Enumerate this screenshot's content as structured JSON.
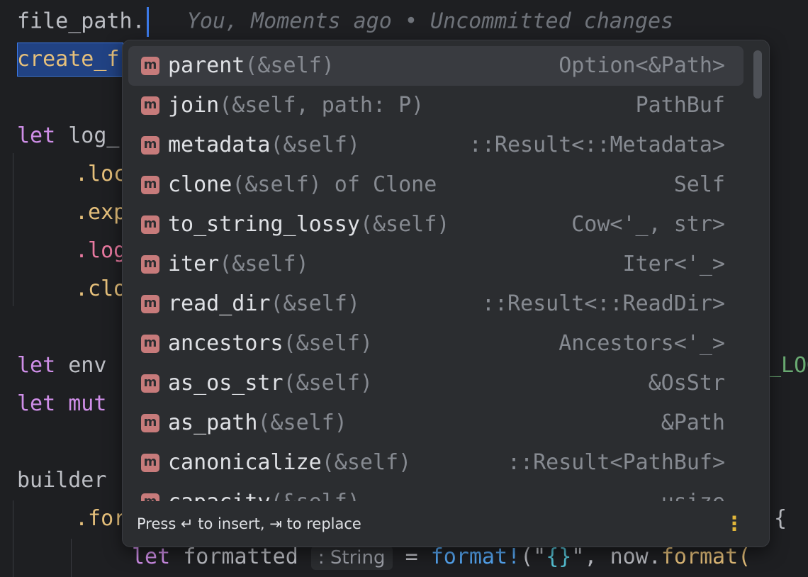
{
  "editor": {
    "line1_text": "file_path.",
    "line1_annotation": "You, Moments ago • Uncommitted changes",
    "line2_text": "create_f",
    "line3_kw": "let",
    "line3_id": "log_",
    "line4": ".loc",
    "line5": ".exp",
    "line6": ".log",
    "line7": ".clo",
    "line8_kw": "let",
    "line8_id": "env",
    "line8_tail": "_LOG",
    "line9_kw": "let mut",
    "line10": "builder",
    "line11": ".for",
    "line11_tail": "{",
    "line12_kw": "let",
    "line12_id": "formatted",
    "line12_hint": ": String",
    "line12_eq": "=",
    "line12_macro": "format!",
    "line12_str_open": "(\"",
    "line12_braces": "{}",
    "line12_str_close": "\",",
    "line12_now": "now.",
    "line12_fn": "format(",
    "colors": {
      "background": "#1e1f22",
      "keyword": "#cf8ee8",
      "method_badge": "#c77b7b",
      "popup": "#2b2d30"
    }
  },
  "completion": {
    "items": [
      {
        "icon": "method-icon",
        "badge": "m",
        "name": "parent",
        "sig": "(&self)",
        "type": "Option<&Path>",
        "selected": true
      },
      {
        "icon": "method-icon",
        "badge": "m",
        "name": "join",
        "sig": "(&self, path: P)",
        "type": "PathBuf"
      },
      {
        "icon": "method-icon",
        "badge": "m",
        "name": "metadata",
        "sig": "(&self)",
        "type": "::Result<::Metadata>"
      },
      {
        "icon": "method-icon",
        "badge": "m",
        "name": "clone",
        "sig": "(&self) of Clone",
        "type": "Self"
      },
      {
        "icon": "method-icon",
        "badge": "m",
        "name": "to_string_lossy",
        "sig": "(&self)",
        "type": "Cow<'_, str>"
      },
      {
        "icon": "method-icon",
        "badge": "m",
        "name": "iter",
        "sig": "(&self)",
        "type": "Iter<'_>"
      },
      {
        "icon": "method-icon",
        "badge": "m",
        "name": "read_dir",
        "sig": "(&self)",
        "type": "::Result<::ReadDir>"
      },
      {
        "icon": "method-icon",
        "badge": "m",
        "name": "ancestors",
        "sig": "(&self)",
        "type": "Ancestors<'_>"
      },
      {
        "icon": "method-icon",
        "badge": "m",
        "name": "as_os_str",
        "sig": "(&self)",
        "type": "&OsStr"
      },
      {
        "icon": "method-icon",
        "badge": "m",
        "name": "as_path",
        "sig": "(&self)",
        "type": "&Path"
      },
      {
        "icon": "method-icon",
        "badge": "m",
        "name": "canonicalize",
        "sig": "(&self)",
        "type": "::Result<PathBuf>"
      },
      {
        "icon": "method-icon",
        "badge": "m",
        "name": "capacity",
        "sig": "(&self)",
        "type": "usize"
      }
    ],
    "footer": "Press ↵ to insert, ⇥ to replace",
    "more_icon": "more-vertical-icon"
  }
}
